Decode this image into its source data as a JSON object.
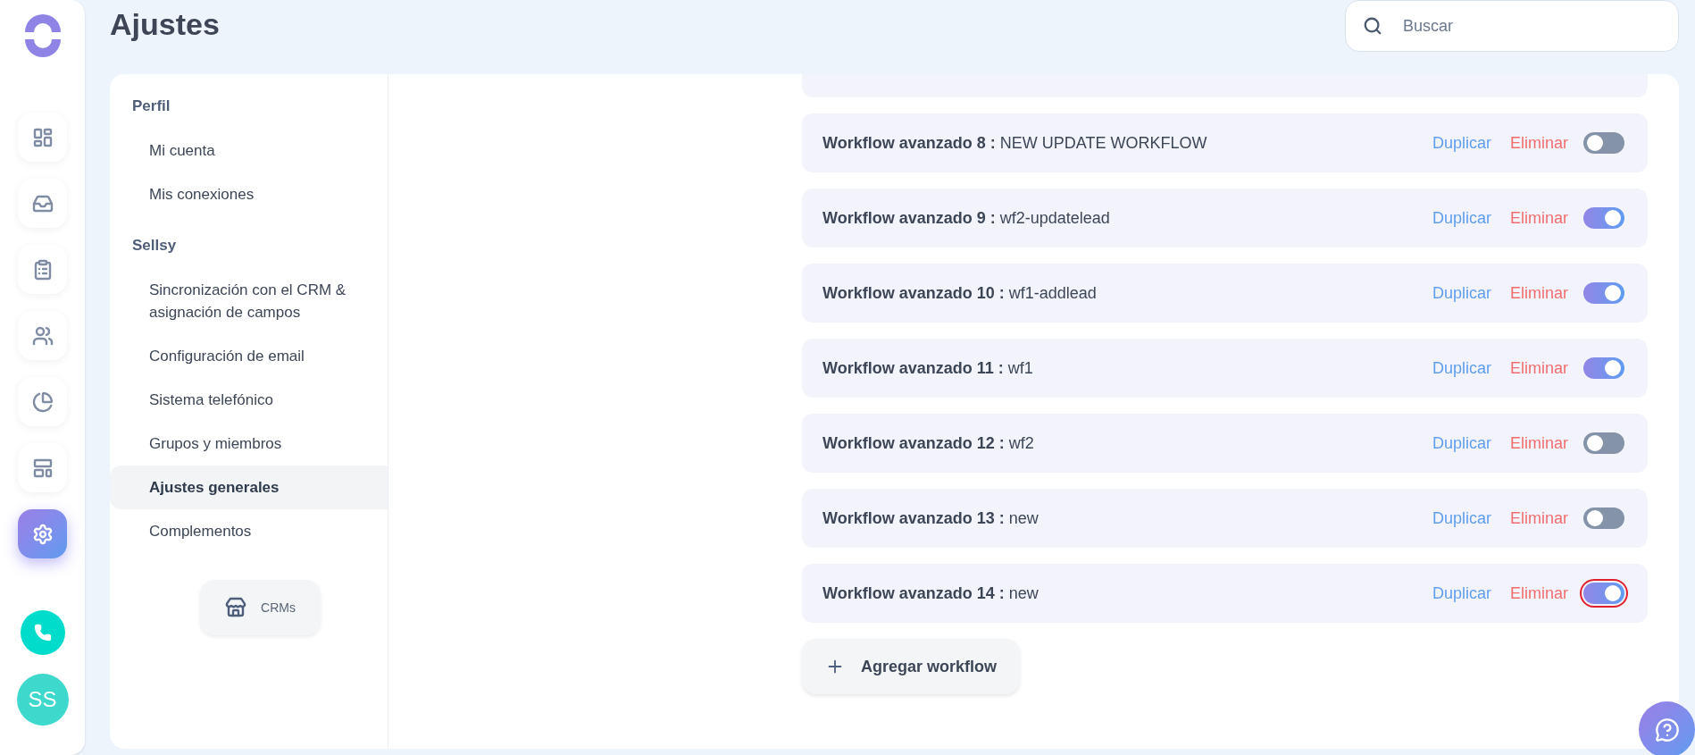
{
  "rail": {
    "items": [
      {
        "kind": "dashboard",
        "selected": false
      },
      {
        "kind": "inbox",
        "selected": false
      },
      {
        "kind": "clipboard",
        "selected": false
      },
      {
        "kind": "people",
        "selected": false
      },
      {
        "kind": "pie",
        "selected": false
      },
      {
        "kind": "layout",
        "selected": false
      },
      {
        "kind": "settings",
        "selected": true
      }
    ],
    "avatar": "SS"
  },
  "header": {
    "title": "Ajustes",
    "search": {
      "placeholder": "Buscar"
    }
  },
  "menu": {
    "sections": [
      {
        "title": "Perfil",
        "items": [
          {
            "label": "Mi cuenta",
            "selected": false
          },
          {
            "label": "Mis conexiones",
            "selected": false
          }
        ]
      },
      {
        "title": "Sellsy",
        "items": [
          {
            "label": "Sincronización con el CRM & asignación de campos",
            "selected": false
          },
          {
            "label": "Configuración de email",
            "selected": false
          },
          {
            "label": "Sistema telefónico",
            "selected": false
          },
          {
            "label": "Grupos y miembros",
            "selected": false
          },
          {
            "label": "Ajustes generales",
            "selected": true
          },
          {
            "label": "Complementos",
            "selected": false
          }
        ]
      }
    ],
    "crm_button": "CRMs"
  },
  "workflows": [
    {
      "title": "Workflow avanzado 8 :",
      "name": "NEW UPDATE WORKFLOW",
      "duplicate": "Duplicar",
      "delete": "Eliminar",
      "on": false,
      "focused": false
    },
    {
      "title": "Workflow avanzado 9 :",
      "name": "wf2-updatelead",
      "duplicate": "Duplicar",
      "delete": "Eliminar",
      "on": true,
      "focused": false
    },
    {
      "title": "Workflow avanzado 10 :",
      "name": "wf1-addlead",
      "duplicate": "Duplicar",
      "delete": "Eliminar",
      "on": true,
      "focused": false
    },
    {
      "title": "Workflow avanzado 11 :",
      "name": "wf1",
      "duplicate": "Duplicar",
      "delete": "Eliminar",
      "on": true,
      "focused": false
    },
    {
      "title": "Workflow avanzado 12 :",
      "name": "wf2",
      "duplicate": "Duplicar",
      "delete": "Eliminar",
      "on": false,
      "focused": false
    },
    {
      "title": "Workflow avanzado 13 :",
      "name": "new",
      "duplicate": "Duplicar",
      "delete": "Eliminar",
      "on": false,
      "focused": false
    },
    {
      "title": "Workflow avanzado 14 :",
      "name": "new",
      "duplicate": "Duplicar",
      "delete": "Eliminar",
      "on": true,
      "focused": true
    }
  ],
  "add_button": "Agregar workflow"
}
